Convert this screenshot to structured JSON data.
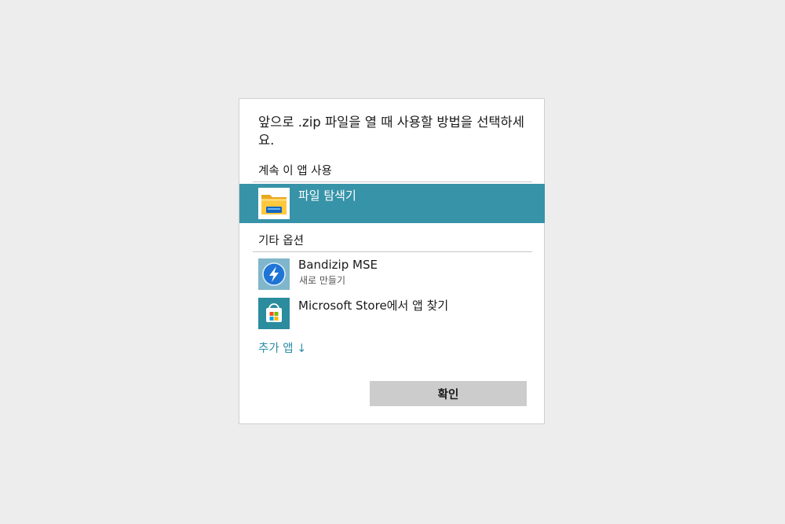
{
  "dialog": {
    "title": "앞으로 .zip 파일을 열 때 사용할 방법을 선택하세요.",
    "continue_section_label": "계속 이 앱 사용",
    "other_section_label": "기타 옵션",
    "more_apps_label": "추가 앱 ↓",
    "ok_label": "확인"
  },
  "apps": {
    "current": {
      "name": "파일 탐색기",
      "icon": "file-explorer-icon"
    },
    "others": [
      {
        "name": "Bandizip MSE",
        "subtitle": "새로 만들기",
        "icon": "bandizip-icon"
      },
      {
        "name": "Microsoft Store에서 앱 찾기",
        "icon": "microsoft-store-icon"
      }
    ]
  },
  "colors": {
    "selected_row": "#3793a8",
    "link": "#2f8fa6",
    "button": "#cccccc",
    "background": "#ededed"
  }
}
